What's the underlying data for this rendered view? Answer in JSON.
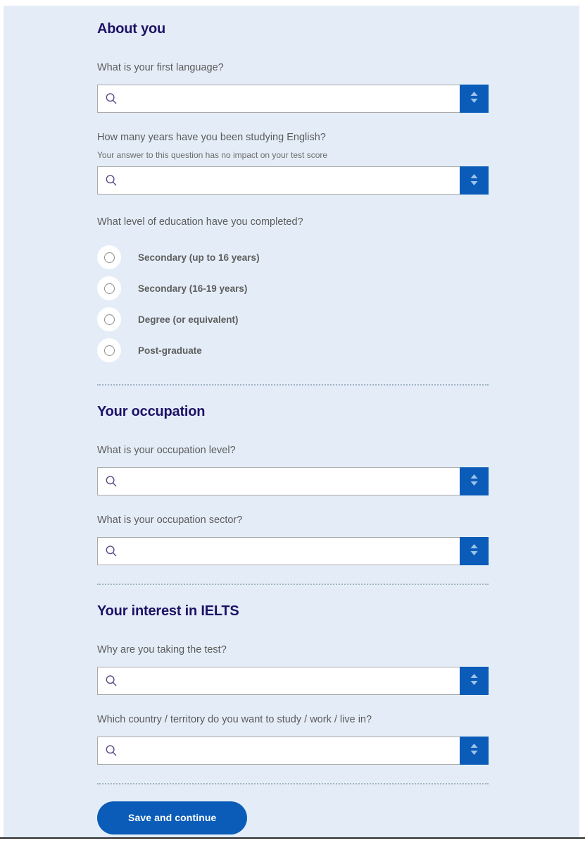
{
  "theme": {
    "panel_bg": "#e4edf7",
    "heading_color": "#1d1266",
    "accent_blue": "#0a5cb8",
    "label_color": "#5b5b5b",
    "divider_color": "#9fb2c4",
    "search_icon_color": "#5b4a86"
  },
  "sections": [
    {
      "id": "about-you",
      "heading": "About you",
      "questions": [
        {
          "id": "first-language",
          "type": "search-select",
          "label": "What is your first language?",
          "hint": "",
          "value": "",
          "placeholder": "",
          "search_icon": "search-icon",
          "stepper_icon": "up-down-chevron-icon"
        },
        {
          "id": "years-studying-english",
          "type": "search-select",
          "label": "How many years have you been studying English?",
          "hint": "Your answer to this question has no impact on your test score",
          "value": "",
          "placeholder": "",
          "search_icon": "search-icon",
          "stepper_icon": "up-down-chevron-icon"
        },
        {
          "id": "education-level",
          "type": "radio-group",
          "label": "What level of education have you completed?",
          "hint": "",
          "selected": "",
          "options": [
            "Secondary (up to 16 years)",
            "Secondary (16-19 years)",
            "Degree (or equivalent)",
            "Post-graduate"
          ]
        }
      ]
    },
    {
      "id": "your-occupation",
      "heading": "Your occupation",
      "questions": [
        {
          "id": "occupation-level",
          "type": "search-select",
          "label": "What is your occupation level?",
          "hint": "",
          "value": "",
          "placeholder": "",
          "search_icon": "search-icon",
          "stepper_icon": "up-down-chevron-icon"
        },
        {
          "id": "occupation-sector",
          "type": "search-select",
          "label": "What is your occupation sector?",
          "hint": "",
          "value": "",
          "placeholder": "",
          "search_icon": "search-icon",
          "stepper_icon": "up-down-chevron-icon"
        }
      ]
    },
    {
      "id": "your-interest-in-ielts",
      "heading": "Your interest in IELTS",
      "questions": [
        {
          "id": "why-taking-test",
          "type": "search-select",
          "label": "Why are you taking the test?",
          "hint": "",
          "value": "",
          "placeholder": "",
          "search_icon": "search-icon",
          "stepper_icon": "up-down-chevron-icon"
        },
        {
          "id": "destination-country",
          "type": "search-select",
          "label": "Which country / territory do you want to study / work / live in?",
          "hint": "",
          "value": "",
          "placeholder": "",
          "search_icon": "search-icon",
          "stepper_icon": "up-down-chevron-icon"
        }
      ]
    }
  ],
  "footer": {
    "submit_label": "Save and continue"
  }
}
